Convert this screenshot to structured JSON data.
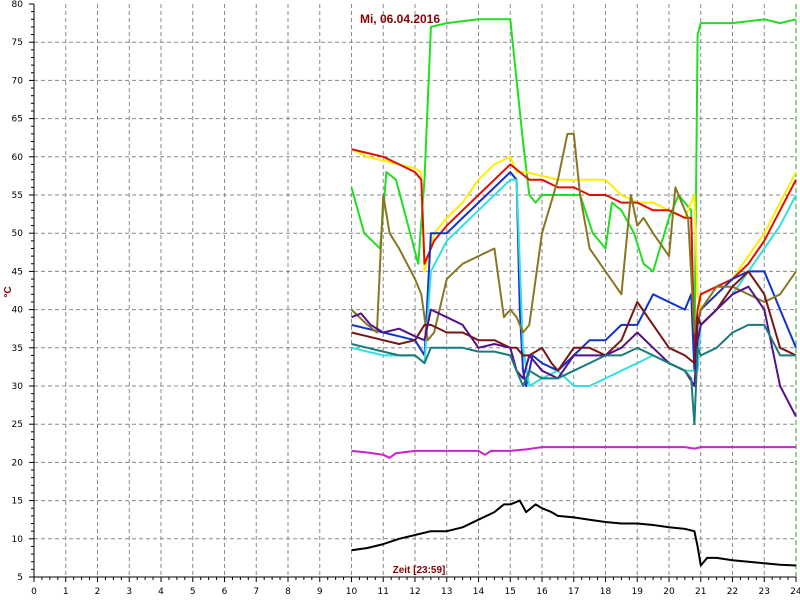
{
  "chart_data": {
    "type": "line",
    "title": "Mi, 06.04.2016",
    "xlabel": "Zeit [23:59]",
    "ylabel": "°C",
    "xlim": [
      0,
      24
    ],
    "ylim": [
      5,
      80
    ],
    "x_ticks": [
      "0",
      "1",
      "2",
      "3",
      "4",
      "5",
      "6",
      "7",
      "8",
      "9",
      "10",
      "11",
      "12",
      "13",
      "14",
      "15",
      "16",
      "17",
      "18",
      "19",
      "20",
      "21",
      "22",
      "23",
      "24"
    ],
    "y_ticks": [
      "5",
      "10",
      "15",
      "20",
      "25",
      "30",
      "35",
      "40",
      "45",
      "50",
      "55",
      "60",
      "65",
      "70",
      "75",
      "80"
    ],
    "grid": true,
    "series": [
      {
        "color": "#22dd22",
        "x": [
          10,
          10.4,
          10.9,
          11.1,
          11.4,
          12.1,
          12.3,
          12.5,
          13.0,
          14.0,
          15.0,
          15.2,
          15.4,
          15.6,
          15.8,
          16.0,
          16.3,
          16.5,
          16.8,
          17.2,
          17.6,
          18.0,
          18.2,
          18.5,
          18.9,
          19.2,
          19.5,
          20.0,
          20.3,
          20.7,
          20.8,
          20.9,
          21.0,
          21.5,
          22.0,
          23.0,
          23.5,
          24.0
        ],
        "y": [
          56,
          50,
          48,
          58,
          57,
          46,
          57,
          77,
          77.5,
          78,
          78,
          70,
          62,
          55,
          54,
          55,
          55,
          55,
          55,
          55,
          50,
          48,
          54,
          53,
          50,
          46,
          45,
          52,
          55,
          53,
          33,
          76,
          77.5,
          77.5,
          77.5,
          78,
          77.5,
          78
        ]
      },
      {
        "color": "#ffee00",
        "x": [
          10,
          10.5,
          11,
          11.5,
          12.0,
          12.2,
          12.3,
          12.6,
          13.0,
          13.5,
          14.0,
          14.5,
          15.0,
          15.2,
          15.5,
          16.0,
          16.5,
          17.0,
          17.5,
          18.0,
          18.5,
          19.0,
          19.5,
          20.0,
          20.5,
          20.8,
          20.9,
          21.0,
          21.5,
          22.0,
          22.5,
          23.0,
          23.5,
          24.0
        ],
        "y": [
          61,
          60,
          59.5,
          59,
          58.5,
          58,
          45,
          50,
          52,
          54,
          57,
          59,
          60,
          58,
          58,
          57.5,
          57,
          57,
          57,
          57,
          55,
          54,
          54,
          53,
          52,
          55,
          42,
          40,
          42,
          44,
          47,
          50,
          54,
          58
        ]
      },
      {
        "color": "#dd1100",
        "x": [
          10,
          10.5,
          11,
          11.5,
          12.0,
          12.2,
          12.3,
          12.6,
          13.0,
          13.5,
          14.0,
          14.5,
          15.0,
          15.3,
          15.6,
          16.0,
          16.5,
          17.0,
          17.5,
          18.0,
          18.5,
          19.0,
          19.5,
          20.0,
          20.5,
          20.7,
          20.8,
          20.9,
          21.0,
          21.5,
          22.0,
          22.5,
          23.0,
          23.5,
          24.0
        ],
        "y": [
          61,
          60.5,
          60,
          59,
          58,
          57,
          46,
          49,
          51,
          53,
          55,
          57,
          59,
          58,
          57,
          57,
          56,
          56,
          55,
          55,
          54,
          54,
          53,
          53,
          52,
          52,
          35,
          40,
          42,
          43,
          44,
          46,
          49,
          53,
          57
        ]
      },
      {
        "color": "#1133cc",
        "x": [
          10,
          10.5,
          11,
          11.5,
          12.0,
          12.3,
          12.5,
          13.0,
          13.5,
          14.0,
          14.5,
          15.0,
          15.2,
          15.3,
          15.4,
          15.5,
          15.7,
          16.0,
          16.5,
          17.0,
          17.5,
          18.0,
          18.5,
          19.0,
          19.5,
          20.0,
          20.5,
          20.7,
          20.8,
          20.9,
          21.0,
          21.5,
          22.0,
          22.5,
          23.0,
          23.5,
          24.0
        ],
        "y": [
          38,
          37.5,
          37,
          36.5,
          36,
          34,
          50,
          50,
          52,
          54,
          56,
          58,
          57,
          40,
          32,
          30,
          34,
          33,
          32,
          34,
          36,
          36,
          38,
          38,
          42,
          41,
          40,
          42,
          32,
          38,
          40,
          42,
          44,
          45,
          45,
          40,
          35
        ]
      },
      {
        "color": "#33e0e0",
        "x": [
          10,
          10.5,
          11,
          11.5,
          12.0,
          12.3,
          12.5,
          13.0,
          13.5,
          14.0,
          14.5,
          15.0,
          15.2,
          15.4,
          15.6,
          16.0,
          16.5,
          17.0,
          17.5,
          18.0,
          18.5,
          19.0,
          19.5,
          20.0,
          20.5,
          20.8,
          20.9,
          21.0,
          21.5,
          22.0,
          22.5,
          23.0,
          23.5,
          24.0
        ],
        "y": [
          35,
          34.5,
          34,
          34,
          34,
          33,
          45,
          49,
          51,
          53,
          55,
          57,
          57,
          35,
          30,
          31,
          32,
          30,
          30,
          31,
          32,
          33,
          34,
          33,
          32,
          32,
          32,
          38,
          40,
          42,
          45,
          48,
          51,
          55
        ]
      },
      {
        "color": "#887722",
        "x": [
          10,
          10.5,
          10.8,
          11.0,
          11.2,
          11.5,
          12.0,
          12.2,
          12.4,
          12.6,
          13.0,
          13.5,
          14.0,
          14.5,
          14.8,
          15.0,
          15.2,
          15.4,
          15.6,
          16.0,
          16.5,
          16.8,
          17.0,
          17.2,
          17.5,
          18.0,
          18.5,
          18.8,
          19.0,
          19.2,
          19.5,
          20.0,
          20.2,
          20.4,
          20.6,
          20.8,
          21.0,
          21.5,
          22.0,
          22.5,
          23.0,
          23.5,
          24.0
        ],
        "y": [
          40,
          38,
          37,
          55,
          50,
          48,
          44,
          42,
          36,
          37,
          44,
          46,
          47,
          48,
          39,
          40,
          39,
          37,
          38,
          50,
          57,
          63,
          63,
          55,
          48,
          45,
          42,
          55,
          51,
          52,
          50,
          47,
          56,
          54,
          52,
          37,
          40,
          43,
          43,
          42,
          41,
          42,
          45
        ]
      },
      {
        "color": "#7a1515",
        "x": [
          10,
          10.5,
          11,
          11.5,
          12.0,
          12.3,
          12.5,
          13.0,
          13.5,
          14.0,
          14.5,
          15.0,
          15.2,
          15.4,
          15.6,
          16.0,
          16.3,
          16.5,
          17.0,
          17.5,
          18.0,
          18.5,
          18.8,
          19.0,
          19.5,
          20.0,
          20.5,
          20.8,
          20.9,
          21.0,
          21.5,
          22.0,
          22.5,
          23.0,
          23.5,
          24.0
        ],
        "y": [
          37,
          36.5,
          36,
          35.5,
          36,
          38,
          38,
          37,
          37,
          36,
          36,
          35,
          35,
          34,
          34,
          35,
          33,
          32,
          35,
          35,
          34,
          36,
          39,
          41,
          38,
          35,
          34,
          33,
          39,
          38,
          40,
          43,
          45,
          42,
          35,
          34
        ]
      },
      {
        "color": "#55118a",
        "x": [
          10,
          10.3,
          10.6,
          11,
          11.5,
          12.0,
          12.3,
          12.5,
          13.0,
          13.5,
          14.0,
          14.5,
          15.0,
          15.2,
          15.4,
          15.6,
          16.0,
          16.5,
          17.0,
          17.5,
          18.0,
          18.5,
          19.0,
          19.5,
          20.0,
          20.5,
          20.8,
          20.9,
          21.0,
          21.5,
          22.0,
          22.5,
          23.0,
          23.5,
          24.0
        ],
        "y": [
          39,
          39.5,
          38,
          37,
          37.5,
          36.5,
          36,
          40,
          39,
          38,
          35,
          35.5,
          35,
          32,
          31,
          34,
          32,
          31,
          34,
          34,
          34,
          35,
          37,
          35,
          33,
          32,
          30,
          36,
          38,
          40,
          42,
          43,
          40,
          30,
          26
        ]
      },
      {
        "color": "#1a7a7a",
        "x": [
          10,
          10.5,
          11,
          11.5,
          12.0,
          12.3,
          12.5,
          13.0,
          13.5,
          14.0,
          14.5,
          15.0,
          15.2,
          15.4,
          15.6,
          16.0,
          16.5,
          17.0,
          17.5,
          18.0,
          18.5,
          19.0,
          19.5,
          20.0,
          20.5,
          20.7,
          20.8,
          20.9,
          21.0,
          21.5,
          22.0,
          22.5,
          23.0,
          23.5,
          24.0
        ],
        "y": [
          35.5,
          35,
          34.5,
          34,
          34,
          33,
          35,
          35,
          35,
          34.5,
          34.5,
          34,
          32,
          30,
          32,
          31,
          31,
          32,
          33,
          34,
          34,
          35,
          34,
          33,
          32,
          31,
          25,
          35,
          34,
          35,
          37,
          38,
          38,
          34,
          34
        ]
      },
      {
        "color": "#cc22cc",
        "x": [
          10,
          10.5,
          11,
          11.2,
          11.4,
          12,
          13,
          14,
          14.2,
          14.4,
          15,
          15.5,
          16,
          17,
          18,
          19,
          20,
          20.5,
          20.8,
          21,
          22,
          23,
          24
        ],
        "y": [
          21.5,
          21.3,
          21,
          20.6,
          21.2,
          21.5,
          21.5,
          21.5,
          21,
          21.5,
          21.5,
          21.7,
          22,
          22,
          22,
          22,
          22,
          22,
          21.8,
          22,
          22,
          22,
          22
        ]
      },
      {
        "color": "#000000",
        "x": [
          10,
          10.5,
          11,
          11.5,
          12,
          12.5,
          13,
          13.5,
          14,
          14.5,
          14.8,
          15,
          15.3,
          15.5,
          15.8,
          16.0,
          16.3,
          16.5,
          17.0,
          17.5,
          18.0,
          18.5,
          19.0,
          19.5,
          20.0,
          20.5,
          20.8,
          20.9,
          21.0,
          21.2,
          21.5,
          22.0,
          22.5,
          23.0,
          23.5,
          24.0
        ],
        "y": [
          8.5,
          8.8,
          9.3,
          10,
          10.5,
          11,
          11,
          11.5,
          12.5,
          13.5,
          14.5,
          14.5,
          15,
          13.5,
          14.5,
          14,
          13.5,
          13,
          12.8,
          12.5,
          12.2,
          12,
          12,
          11.8,
          11.5,
          11.3,
          11,
          9,
          6.5,
          7.5,
          7.5,
          7.2,
          7,
          6.8,
          6.6,
          6.5
        ]
      }
    ]
  }
}
